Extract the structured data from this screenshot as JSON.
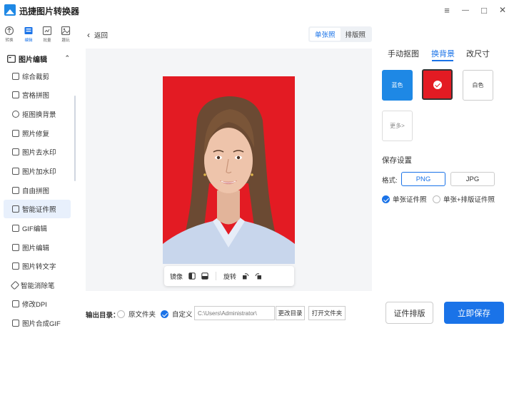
{
  "app": {
    "title": "迅捷图片转换器"
  },
  "window_controls": {
    "menu": "≡",
    "minimize": "—",
    "maximize": "□",
    "close": "✕"
  },
  "mode_tabs": [
    {
      "label": "转换",
      "icon": "convert-icon"
    },
    {
      "label": "编辑",
      "icon": "edit-icon",
      "active": true
    },
    {
      "label": "批量",
      "icon": "batch-icon"
    },
    {
      "label": "趣玩",
      "icon": "fun-icon"
    }
  ],
  "sidebar": {
    "section_title": "图片编辑",
    "items": [
      {
        "label": "综合裁剪",
        "icon": "crop-icon"
      },
      {
        "label": "宫格拼图",
        "icon": "grid-icon"
      },
      {
        "label": "抠图换背景",
        "icon": "cutout-icon"
      },
      {
        "label": "照片修复",
        "icon": "repair-icon"
      },
      {
        "label": "图片去水印",
        "icon": "remove-watermark-icon"
      },
      {
        "label": "图片加水印",
        "icon": "add-watermark-icon"
      },
      {
        "label": "自由拼图",
        "icon": "collage-icon"
      },
      {
        "label": "智能证件照",
        "icon": "id-photo-icon",
        "active": true
      },
      {
        "label": "GIF编辑",
        "icon": "gif-icon"
      },
      {
        "label": "图片编辑",
        "icon": "image-edit-icon"
      },
      {
        "label": "图片转文字",
        "icon": "ocr-icon"
      },
      {
        "label": "智能消除笔",
        "icon": "eraser-icon"
      },
      {
        "label": "修改DPI",
        "icon": "dpi-icon"
      },
      {
        "label": "图片合成GIF",
        "icon": "make-gif-icon"
      }
    ]
  },
  "main": {
    "back_label": "返回",
    "view_modes": [
      "单张照",
      "排版照"
    ],
    "toolbar": {
      "mirror": "镜像",
      "rotate": "旋转"
    }
  },
  "right_panel": {
    "tabs": [
      "手动抠图",
      "换背景",
      "改尺寸"
    ],
    "backgrounds": {
      "blue": "蓝色",
      "white": "白色",
      "more": "更多>"
    },
    "save_settings_title": "保存设置",
    "format_label": "格式:",
    "formats": [
      "PNG",
      "JPG"
    ],
    "options": [
      "单张证件照",
      "单张+排版证件照"
    ]
  },
  "bottom": {
    "output_label": "输出目录：",
    "original_folder": "原文件夹",
    "custom": "自定义",
    "path_placeholder": "C:\\Users\\Administrator\\",
    "change_dir": "更改目录",
    "open_folder": "打开文件夹",
    "layout_button": "证件排版",
    "save_button": "立即保存"
  },
  "colors": {
    "accent": "#1a73e8",
    "background_red": "#e31b23",
    "background_blue": "#1e88e5"
  }
}
